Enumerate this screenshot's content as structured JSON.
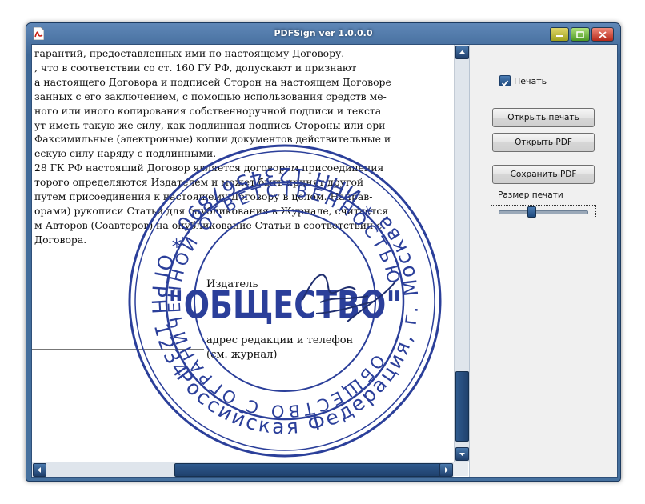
{
  "window": {
    "title": "PDFSign ver 1.0.0.0"
  },
  "document": {
    "lines": [
      "гарантий, предоставленных ими по настоящему Договору.",
      ", что в соответствии со ст. 160 ГУ РФ, допускают и признают",
      "а настоящего Договора и подписей Сторон на настоящем Договоре",
      "занных с его заключением, с помощью использования средств ме-",
      "ного или иного копирования собственноручной подписи и текста",
      "ут иметь такую же силу, как подлинная подпись Стороны или ори-",
      "Факсимильные (электронные) копии документов действительные и",
      "ескую силу наряду с подлинными.",
      "28 ГК РФ настоящий Договор является договором присоединения",
      "торого определяются Издателем и может быть принят другой",
      "путем присоединения к настоящему Договору в целом. Направ-",
      "орами) рукописи Статьи для опубликования в Журнале, считается",
      "м Авторов (Соавторов) на опубликование Статьи в соответствии с",
      "Договора."
    ],
    "publisher_label": "Издатель",
    "address_line1": "адрес редакции и телефон",
    "address_line2": "(см. журнал)"
  },
  "stamp": {
    "center_text": "\"ОБЩЕСТВО\"",
    "outer_ring_text": "Российская Федерация, г. Москва * ИНН 1234567890 * ОГРН 1234567890000 *",
    "inner_ring_text": "ОБЩЕСТВО С ОГРАНИЧЕННОЙ ОТВЕТСТВЕННОСТЬЮ",
    "color": "#2b3f9a"
  },
  "panel": {
    "print_checkbox_label": "Печать",
    "print_checked": true,
    "open_stamp_button": "Открыть печать",
    "open_pdf_button": "Открыть PDF",
    "save_pdf_button": "Сохранить PDF",
    "stamp_size_label": "Размер печати",
    "stamp_size_value": 0.35
  },
  "icons": {
    "app": "pdf-app-icon",
    "minimize": "minimize-icon",
    "maximize": "maximize-icon",
    "close": "close-icon"
  }
}
